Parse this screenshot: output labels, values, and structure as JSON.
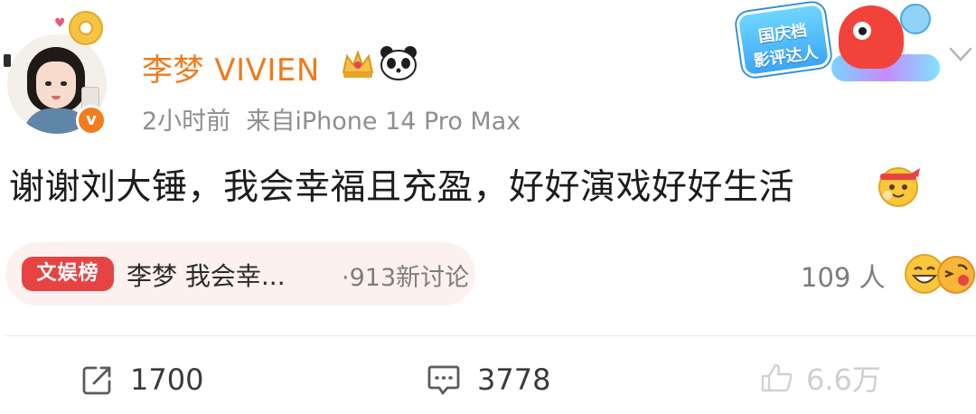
{
  "user": {
    "name": "李梦 VIVIEN",
    "verified_mark": "v",
    "meta": "2小时前  来自iPhone 14 Pro Max"
  },
  "sticker": {
    "line1": "国庆档",
    "line2": "影评达人"
  },
  "post": {
    "text": "谢谢刘大锤，我会幸福且充盈，好好演戏好好生活"
  },
  "topic": {
    "badge": "文娱榜",
    "text": "李梦 我会幸...",
    "count": "·913新讨论"
  },
  "reactions": {
    "people": "109 人"
  },
  "actions": {
    "share": "1700",
    "comment": "3778",
    "like": "6.6万"
  },
  "colors": {
    "name": "#f07a1a",
    "meta": "#8e8e8e",
    "badge": "#e84343",
    "pill": "#fdf1ef",
    "verified": "#f37c1d"
  },
  "icons": [
    "camera-icon",
    "verified-icon",
    "crown-icon",
    "panda-icon",
    "chevron-down-icon",
    "headband-emoji-icon",
    "laugh-emoji-icon",
    "kiss-emoji-icon",
    "share-icon",
    "comment-icon",
    "like-icon"
  ]
}
